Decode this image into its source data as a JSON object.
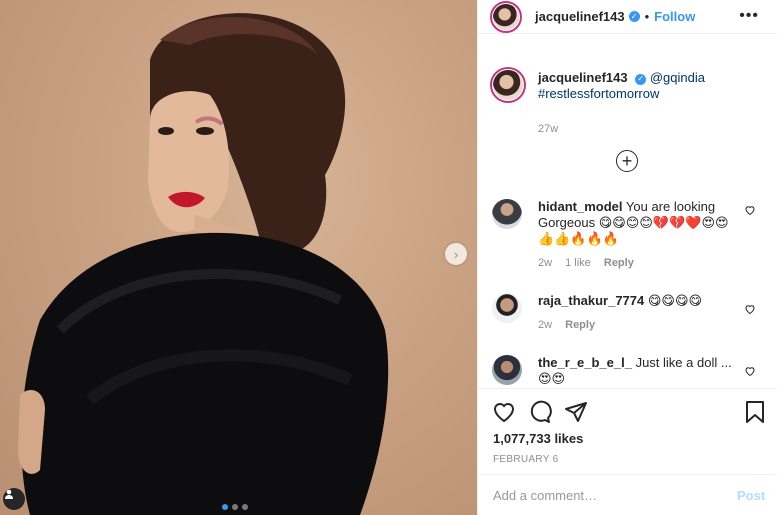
{
  "post": {
    "username": "jacquelinef143",
    "follow_label": "Follow",
    "separator": "•",
    "more_label": "•••",
    "media": {
      "current_slide": 1,
      "total_slides": 3,
      "description_icon": "portrait-photo"
    },
    "caption": {
      "username": "jacquelinef143",
      "mention": "@gqindia",
      "hashtag": "#restlessfortomorrow",
      "time": "27w"
    },
    "comments": [
      {
        "username": "hidant_model",
        "text": "You are looking Gorgeous 😋😋😊😊💔💔❤️😍😍👍👍🔥🔥🔥",
        "time": "2w",
        "likes": "1 like",
        "reply_label": "Reply"
      },
      {
        "username": "raja_thakur_7774",
        "text": "😋😋😋😋",
        "time": "2w",
        "likes": "",
        "reply_label": "Reply"
      },
      {
        "username": "the_r_e_b_e_l_",
        "text": "Just like a doll ...😍😍",
        "time": "",
        "likes": "",
        "reply_label": ""
      }
    ],
    "likes": "1,077,733 likes",
    "date": "FEBRUARY 6",
    "comment_placeholder": "Add a comment…",
    "post_label": "Post"
  },
  "colors": {
    "accent": "#3897f0",
    "link": "#003569",
    "heart": "#ed4956",
    "muted": "#8e8e8e"
  }
}
